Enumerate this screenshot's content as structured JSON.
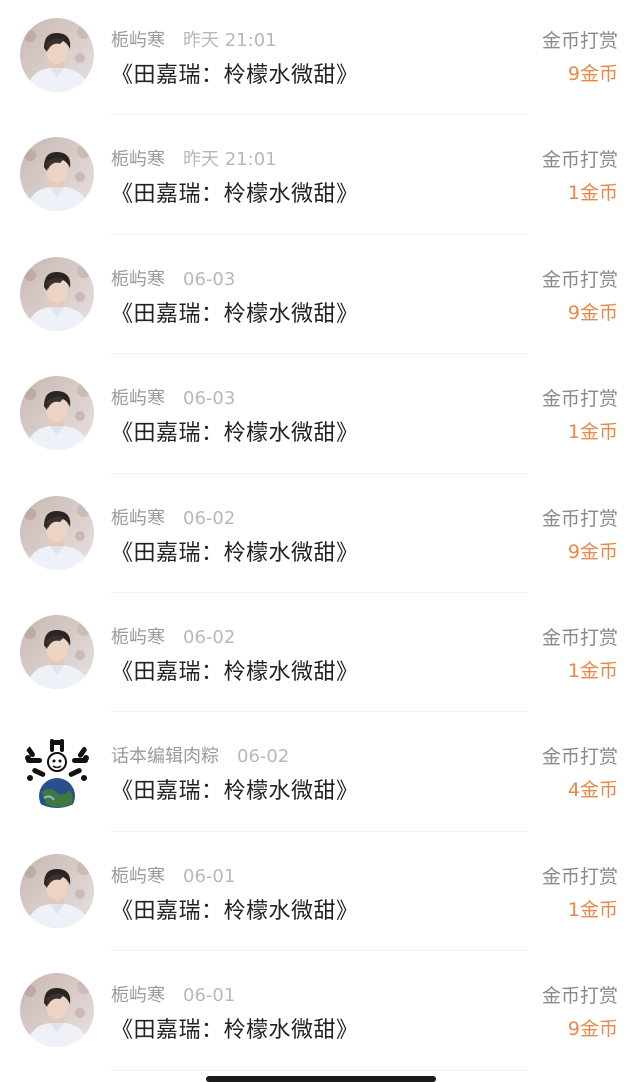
{
  "colors": {
    "amount": "#e8894a",
    "name": "#9a9a9a",
    "time": "#b8b8b8",
    "title": "#222222"
  },
  "records": [
    {
      "user": "栀屿寒",
      "time": "昨天 21:01",
      "work": "《田嘉瑞：柃檬水微甜》",
      "type": "金币打赏",
      "amount": "9金币",
      "avatar": "person-photo-avatar"
    },
    {
      "user": "栀屿寒",
      "time": "昨天 21:01",
      "work": "《田嘉瑞：柃檬水微甜》",
      "type": "金币打赏",
      "amount": "1金币",
      "avatar": "person-photo-avatar"
    },
    {
      "user": "栀屿寒",
      "time": "06-03",
      "work": "《田嘉瑞：柃檬水微甜》",
      "type": "金币打赏",
      "amount": "9金币",
      "avatar": "person-photo-avatar"
    },
    {
      "user": "栀屿寒",
      "time": "06-03",
      "work": "《田嘉瑞：柃檬水微甜》",
      "type": "金币打赏",
      "amount": "1金币",
      "avatar": "person-photo-avatar"
    },
    {
      "user": "栀屿寒",
      "time": "06-02",
      "work": "《田嘉瑞：柃檬水微甜》",
      "type": "金币打赏",
      "amount": "9金币",
      "avatar": "person-photo-avatar"
    },
    {
      "user": "栀屿寒",
      "time": "06-02",
      "work": "《田嘉瑞：柃檬水微甜》",
      "type": "金币打赏",
      "amount": "1金币",
      "avatar": "person-photo-avatar"
    },
    {
      "user": "话本编辑肉粽",
      "time": "06-02",
      "work": "《田嘉瑞：柃檬水微甜》",
      "type": "金币打赏",
      "amount": "4金币",
      "avatar": "earth-cartoon-avatar"
    },
    {
      "user": "栀屿寒",
      "time": "06-01",
      "work": "《田嘉瑞：柃檬水微甜》",
      "type": "金币打赏",
      "amount": "1金币",
      "avatar": "person-photo-avatar"
    },
    {
      "user": "栀屿寒",
      "time": "06-01",
      "work": "《田嘉瑞：柃檬水微甜》",
      "type": "金币打赏",
      "amount": "9金币",
      "avatar": "person-photo-avatar"
    }
  ]
}
